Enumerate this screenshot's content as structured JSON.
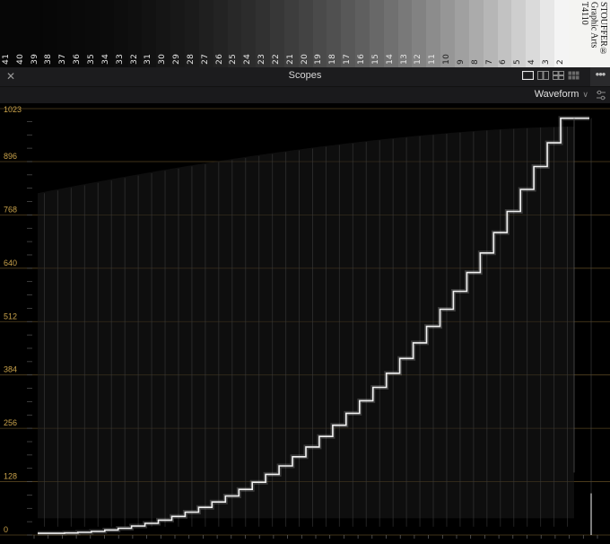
{
  "wedge": {
    "steps": [
      "41",
      "40",
      "39",
      "38",
      "37",
      "36",
      "35",
      "34",
      "33",
      "32",
      "31",
      "30",
      "29",
      "28",
      "27",
      "26",
      "25",
      "24",
      "23",
      "22",
      "21",
      "20",
      "19",
      "18",
      "17",
      "16",
      "15",
      "14",
      "13",
      "12",
      "11",
      "10",
      "9",
      "8",
      "7",
      "6",
      "5",
      "4",
      "3",
      "2"
    ],
    "brand_line1": "STOUFFER®",
    "brand_line2": "Graphic Arts",
    "brand_line3": "T4110"
  },
  "panel": {
    "title": "Scopes",
    "close_icon": "close-icon",
    "layout_icons": [
      "single-layout-icon",
      "dual-layout-icon",
      "quad-layout-icon",
      "grid-layout-icon"
    ],
    "more_icon": "more-icon",
    "scope_type": "Waveform",
    "settings_icon": "settings-icon"
  },
  "scope": {
    "y_ticks": [
      "1023",
      "896",
      "768",
      "640",
      "512",
      "384",
      "256",
      "128",
      "0"
    ],
    "y_max": 1023,
    "tick_color": "#c9a24a",
    "gridline_color": "#6b5428"
  }
}
